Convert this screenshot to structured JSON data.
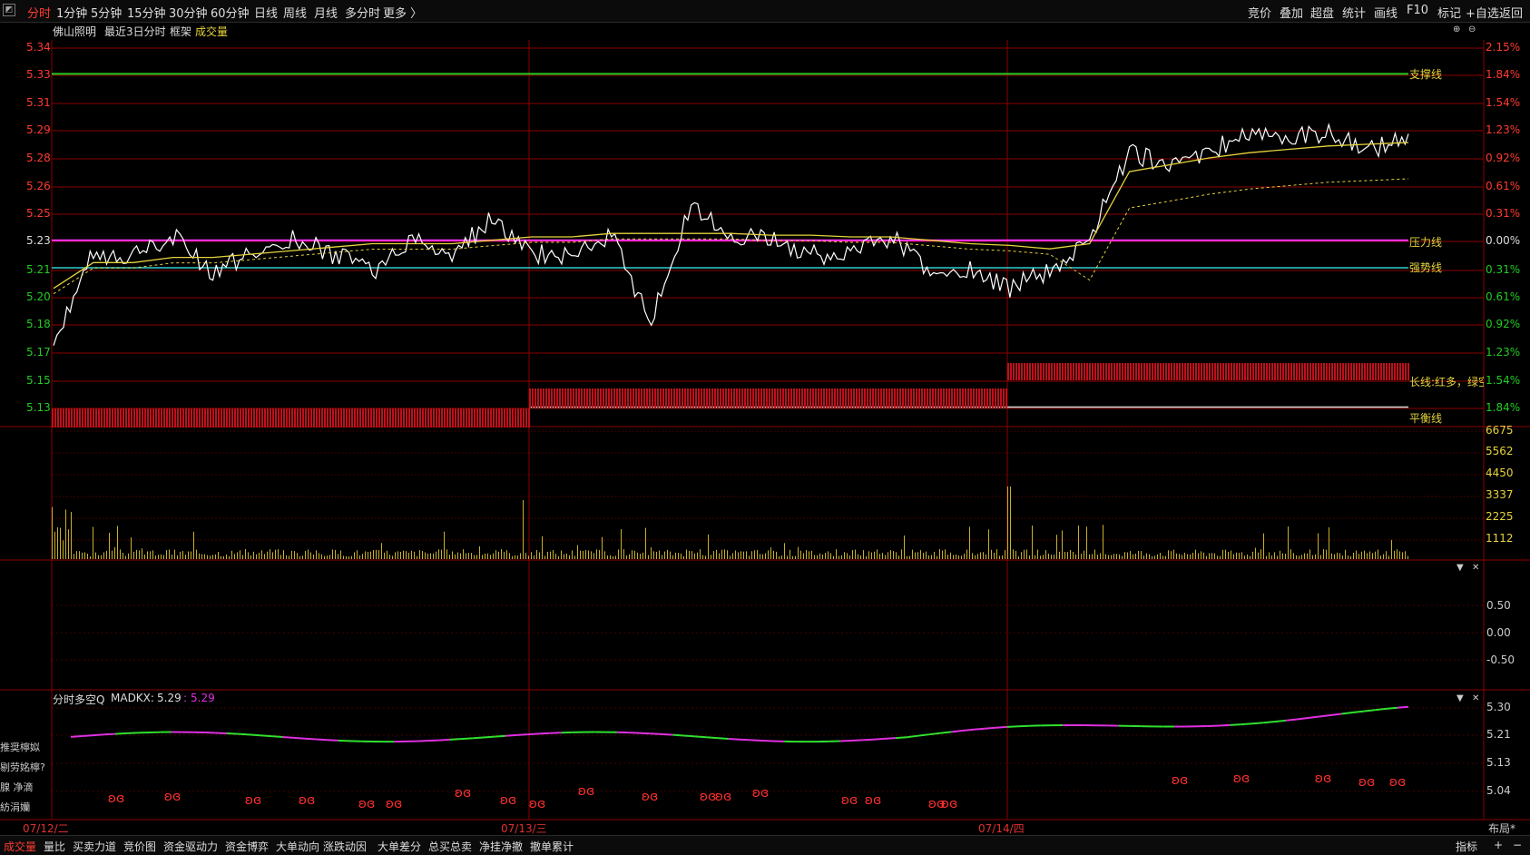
{
  "toolbar": {
    "periods": [
      "分时",
      "1分钟",
      "5分钟",
      "15分钟",
      "30分钟",
      "60分钟",
      "日线",
      "周线",
      "月线",
      "多分时",
      "更多 〉"
    ],
    "active_period": "分时",
    "tools": [
      "竞价",
      "叠加",
      "超盘",
      "统计",
      "画线",
      "F10",
      "标记",
      "+自选",
      "返回"
    ]
  },
  "header": {
    "stock_name": "佛山照明",
    "range_label": "最近3日分时",
    "frame_label": "框架",
    "volume_label": "成交量"
  },
  "price_axis": {
    "left_ticks": [
      "5.34",
      "5.33",
      "5.31",
      "5.29",
      "5.28",
      "5.26",
      "5.25",
      "5.23",
      "5.21",
      "5.20",
      "5.18",
      "5.17",
      "5.15",
      "5.13"
    ],
    "right_ticks": [
      "2.15%",
      "1.84%",
      "1.54%",
      "1.23%",
      "0.92%",
      "0.61%",
      "0.31%",
      "0.00%",
      "0.31%",
      "0.61%",
      "0.92%",
      "1.23%",
      "1.54%",
      "1.84%"
    ],
    "reference_price": "5.23"
  },
  "volume_axis": {
    "ticks": [
      "6675",
      "5562",
      "4450",
      "3337",
      "2225",
      "1112"
    ]
  },
  "indicator_axis": {
    "ticks": [
      "0.50",
      "0.00",
      "-0.50"
    ]
  },
  "madkx_panel": {
    "title": "分时多空Q",
    "name": "MADKX:",
    "value1": "5.29",
    "value2": "5.29",
    "ticks": [
      "5.30",
      "5.21",
      "5.13",
      "5.04"
    ],
    "side_labels": [
      "推奨檸姒",
      "剔劳姳檸?",
      "腺  净滴",
      "  紡涓孏"
    ]
  },
  "line_labels": {
    "support": "支撑线",
    "pressure": "压力线",
    "strong": "强势线",
    "long": "长线:红多，绿空",
    "balance": "平衡线"
  },
  "dates": [
    "07/12/二",
    "07/13/三",
    "07/14/四"
  ],
  "bottom_tabs": [
    "成交量",
    "量比",
    "买卖力道",
    "竞价图",
    "资金驱动力",
    "资金博弈",
    "大单动向",
    "涨跌动因",
    "大单差分",
    "总买总卖",
    "净挂净撤",
    "撤单累计"
  ],
  "bottom_right": [
    "指标",
    "+",
    "−"
  ],
  "layout_label": "布局*",
  "colors": {
    "grid": "#8b0000",
    "support": "#22cc22",
    "pressure": "#ff33ff",
    "strong": "#33cccc",
    "balance": "#dddddd",
    "price": "#ffffff",
    "avg": "#e6d33c",
    "volume": "#c9b02a",
    "bars": "#c0101a",
    "up_tick": "#ff3030",
    "down_tick": "#22cc22",
    "madkx_up": "#e030e0",
    "madkx_down": "#30e030"
  },
  "chart_data": {
    "type": "line",
    "x": [
      "07/12/二",
      "07/13/三",
      "07/14/四"
    ],
    "series": [
      {
        "values": [
          5.17,
          5.22,
          5.22,
          5.23,
          5.21,
          5.22,
          5.23,
          5.22,
          5.21,
          5.23,
          5.22,
          5.24,
          5.22,
          5.22,
          5.23,
          5.18,
          5.25,
          5.23,
          5.23,
          5.22,
          5.22,
          5.23,
          5.21,
          5.21,
          5.2,
          5.21,
          5.23,
          5.28,
          5.27,
          5.28,
          5.29,
          5.29,
          5.29,
          5.28,
          5.29
        ]
      },
      {
        "values": [
          5.2,
          5.215,
          5.215,
          5.218,
          5.218,
          5.22,
          5.222,
          5.224,
          5.226,
          5.226,
          5.226,
          5.228,
          5.23,
          5.23,
          5.232,
          5.232,
          5.232,
          5.232,
          5.231,
          5.231,
          5.23,
          5.23,
          5.228,
          5.226,
          5.225,
          5.223,
          5.226,
          5.268,
          5.272,
          5.276,
          5.279,
          5.281,
          5.283,
          5.284,
          5.285
        ]
      }
    ],
    "ylim": [
      5.12,
      5.35
    ],
    "support": 5.325,
    "pressure": 5.228,
    "strong": 5.212,
    "balance": 5.135
  }
}
